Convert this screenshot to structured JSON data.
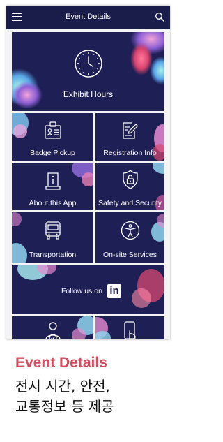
{
  "app": {
    "title": "Event Details"
  },
  "header": {
    "menu_icon": "hamburger-menu-icon",
    "search_icon": "search-icon"
  },
  "tiles": {
    "exhibit_hours": {
      "label": "Exhibit Hours",
      "icon": "clock-icon"
    },
    "badge_pickup": {
      "label": "Badge Pickup",
      "icon": "badge-id-icon"
    },
    "registration_info": {
      "label": "Registration Info",
      "icon": "edit-document-icon"
    },
    "about_app": {
      "label": "About this App",
      "icon": "info-phone-icon"
    },
    "safety_security": {
      "label": "Safety and Security",
      "icon": "shield-lock-icon"
    },
    "transportation": {
      "label": "Transportation",
      "icon": "bus-icon"
    },
    "onsite_services": {
      "label": "On-site Services",
      "icon": "accessibility-icon"
    },
    "follow_us": {
      "label": "Follow us on",
      "icon": "linkedin-icon",
      "brand": "in"
    },
    "partial_left": {
      "icon": "person-check-icon"
    },
    "partial_right": {
      "icon": "phone-tap-icon"
    }
  },
  "caption": {
    "heading": "Event Details",
    "line1": "전시 시간, 안전,",
    "line2": "교통정보 등 제공"
  },
  "colors": {
    "header_bg": "#1a1d4a",
    "tile_bg": "#1e1f55",
    "accent": "#d94a5e",
    "linkedin": "#0a66c2"
  }
}
